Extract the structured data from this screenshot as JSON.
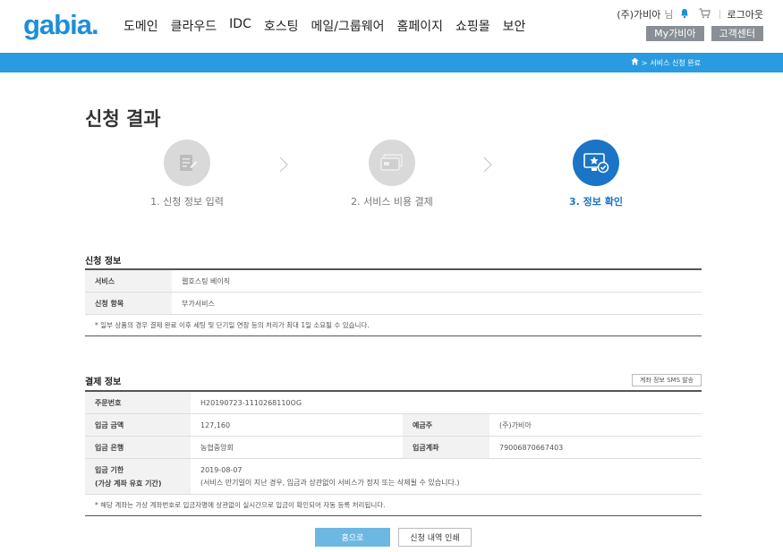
{
  "header": {
    "logo": "gabia",
    "logo_dot": ".",
    "nav": [
      "도메인",
      "클라우드",
      "IDC",
      "호스팅",
      "메일/그룹웨어",
      "홈페이지",
      "쇼핑몰",
      "보안"
    ],
    "user_name": "(주)가비아",
    "user_suffix": "님",
    "logout": "로그아웃",
    "my_gabia": "My가비아",
    "customer_center": "고객센터"
  },
  "breadcrumb": {
    "sep": ">",
    "current": "서비스 신청 완료"
  },
  "page": {
    "title": "신청 결과"
  },
  "steps": [
    {
      "label": "1. 신청 정보 입력",
      "active": false
    },
    {
      "label": "2. 서비스 비용 결제",
      "active": false
    },
    {
      "label": "3. 정보 확인",
      "active": true
    }
  ],
  "application": {
    "title": "신청 정보",
    "rows": [
      {
        "label": "서비스",
        "value": "웹호스팅 베이직"
      },
      {
        "label": "신청 항목",
        "value": "부가서비스"
      }
    ],
    "note": "* 일부 상품의 경우 결제 완료 이후 세팅 및 단기일 연장 등의 처리가 최대 1일 소요될 수 있습니다."
  },
  "payment": {
    "title": "결제 정보",
    "sms_button": "계좌 정보 SMS 발송",
    "order_label": "주문번호",
    "order_value": "H20190723-1110268110OG",
    "amount_label": "입금 금액",
    "amount_value": "127,160",
    "depositor_label": "예금주",
    "depositor_value": "(주)가비아",
    "bank_label": "입금 은행",
    "bank_value": "농협중앙회",
    "account_label": "입금계좌",
    "account_value": "79006870667403",
    "deadline_label": "입금 기한",
    "deadline_sub_label": "(가상 계좌 유효 기간)",
    "deadline_value": "2019-08-07",
    "deadline_note": "(서비스 만기일이 지난 경우, 입금과 상관없이 서비스가 정지 또는 삭제될 수 있습니다.)",
    "note": "* 해당 계좌는 가상 계좌번호로 입금자명에 상관없이 실시간으로 입금이 확인되어 자동 등록 처리됩니다."
  },
  "buttons": {
    "home": "홈으로",
    "print": "신청 내역 인쇄"
  },
  "colors": {
    "brand": "#1e8fd8",
    "bar": "#2a9be0",
    "active_step": "#1b74c6",
    "home_button": "#6cb8e2"
  },
  "icons": {
    "step1": "form-edit-icon",
    "step2": "credit-card-icon",
    "step3": "monitor-check-icon",
    "bell": "bell-icon",
    "cart": "cart-icon",
    "home": "home-icon"
  }
}
